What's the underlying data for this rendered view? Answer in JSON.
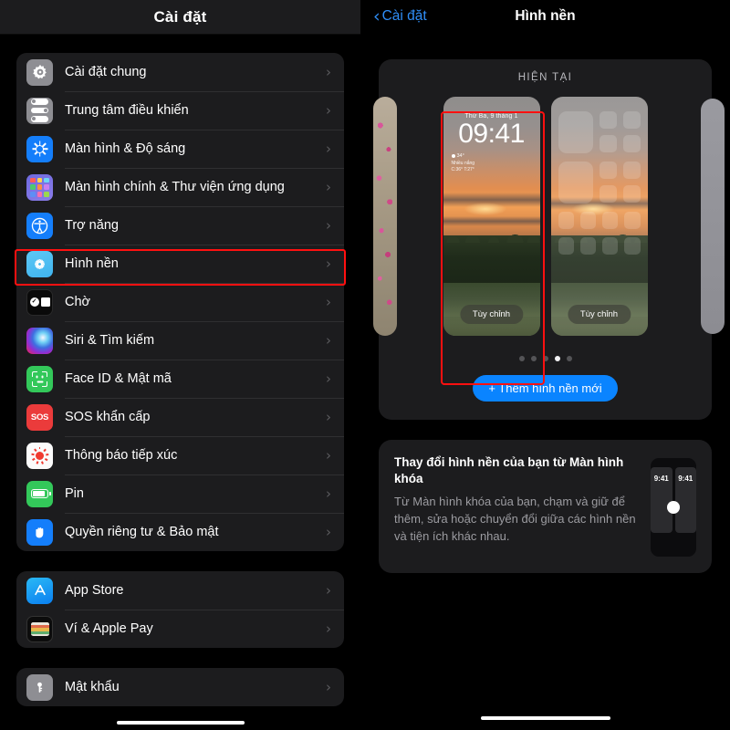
{
  "left": {
    "nav_title": "Cài đặt",
    "groups": [
      {
        "items": [
          {
            "label": "Cài đặt chung",
            "icon": "gear-icon"
          },
          {
            "label": "Trung tâm điều khiển",
            "icon": "control-center-icon"
          },
          {
            "label": "Màn hình & Độ sáng",
            "icon": "brightness-icon"
          },
          {
            "label": "Màn hình chính & Thư viện ứng dụng",
            "icon": "home-screen-icon"
          },
          {
            "label": "Trợ năng",
            "icon": "accessibility-icon"
          },
          {
            "label": "Hình nền",
            "icon": "wallpaper-icon"
          },
          {
            "label": "Chờ",
            "icon": "standby-icon"
          },
          {
            "label": "Siri & Tìm kiếm",
            "icon": "siri-icon"
          },
          {
            "label": "Face ID & Mật mã",
            "icon": "face-id-icon"
          },
          {
            "label": "SOS khẩn cấp",
            "icon": "sos-icon"
          },
          {
            "label": "Thông báo tiếp xúc",
            "icon": "exposure-notification-icon"
          },
          {
            "label": "Pin",
            "icon": "battery-icon"
          },
          {
            "label": "Quyền riêng tư & Bảo mật",
            "icon": "privacy-hand-icon"
          }
        ]
      },
      {
        "items": [
          {
            "label": "App Store",
            "icon": "app-store-icon"
          },
          {
            "label": "Ví & Apple Pay",
            "icon": "wallet-icon"
          }
        ]
      },
      {
        "items": [
          {
            "label": "Mật khẩu",
            "icon": "passwords-key-icon"
          }
        ]
      }
    ],
    "highlighted_item": "Hình nền",
    "chevron": "›"
  },
  "right": {
    "back_label": "Cài đặt",
    "back_chevron": "‹",
    "nav_title": "Hình nền",
    "section_label": "HIỆN TẠI",
    "lock_preview": {
      "date": "Thứ Ba, 9 tháng 1",
      "time": "09:41",
      "weather_temp": "34°",
      "weather_cond": "Nhiều nắng",
      "weather_range": "C:36° T:27°",
      "customize_label": "Tùy chỉnh"
    },
    "home_preview": {
      "customize_label": "Tùy chỉnh"
    },
    "page_dots": {
      "count": 5,
      "active_index": 3
    },
    "add_button": "+ Thêm hình nền mới",
    "tip": {
      "title": "Thay đổi hình nền của bạn từ Màn hình khóa",
      "body": "Từ Màn hình khóa của bạn, chạm và giữ để thêm, sửa hoặc chuyển đổi giữa các hình nền và tiện ích khác nhau.",
      "phone_left_time": "9:41",
      "phone_right_time": "9:41"
    }
  },
  "colors": {
    "accent_blue": "#0a84ff",
    "highlight_red": "#ff1010",
    "card_bg": "#1c1c1e",
    "page_bg": "#000000"
  }
}
